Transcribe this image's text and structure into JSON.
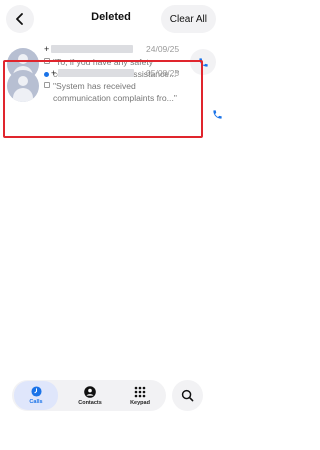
{
  "header": {
    "title": "Deleted",
    "clear_all_label": "Clear All",
    "back_icon": "chevron-left-icon"
  },
  "calls": [
    {
      "number_prefix": "+",
      "date": "24/09/25",
      "unread": false,
      "snippet": "\"To, if you have any safety concerns and need assistance...\""
    },
    {
      "number_prefix": "+",
      "date": "05/08/25",
      "unread": true,
      "snippet": "\"System has received communication complaints fro...\""
    }
  ],
  "bottom_nav": {
    "items": [
      {
        "label": "Calls",
        "icon": "clock-icon",
        "active": true
      },
      {
        "label": "Contacts",
        "icon": "person-icon",
        "active": false
      },
      {
        "label": "Keypad",
        "icon": "keypad-icon",
        "active": false
      }
    ],
    "search_icon": "search-icon"
  },
  "colors": {
    "accent": "#1a73e8",
    "highlight": "#e0252d",
    "button_bg": "#f2f2f4"
  }
}
